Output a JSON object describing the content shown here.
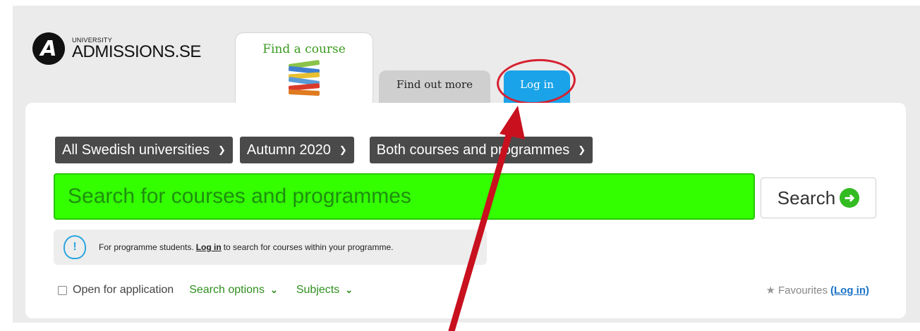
{
  "logo": {
    "small": "UNIVERSITY",
    "big": "ADMISSIONS.SE",
    "badge": "A"
  },
  "tabs": {
    "find_course": "Find a course",
    "find_out_more": "Find out more",
    "log_in": "Log in"
  },
  "filters": {
    "universities": "All Swedish universities",
    "semester": "Autumn 2020",
    "type": "Both courses and programmes"
  },
  "search": {
    "placeholder": "Search for courses and programmes",
    "button": "Search"
  },
  "notice": {
    "before": "For programme students.",
    "link": "Log in",
    "after": "to search for courses within your programme."
  },
  "bottom": {
    "open_label": "Open for application",
    "search_options": "Search options",
    "subjects": "Subjects",
    "favourites": "Favourites",
    "favourites_login": "(Log in)"
  },
  "icons": {
    "chevron": "chevron-down-icon",
    "go": "arrow-right-circle-icon",
    "bulb": "info-bulb-icon",
    "star": "star-icon"
  },
  "colors": {
    "search_bg": "#33ff00",
    "accent_green": "#2f8f1e",
    "login_tab": "#1aa3e8",
    "annotation_red": "#c8101e"
  }
}
